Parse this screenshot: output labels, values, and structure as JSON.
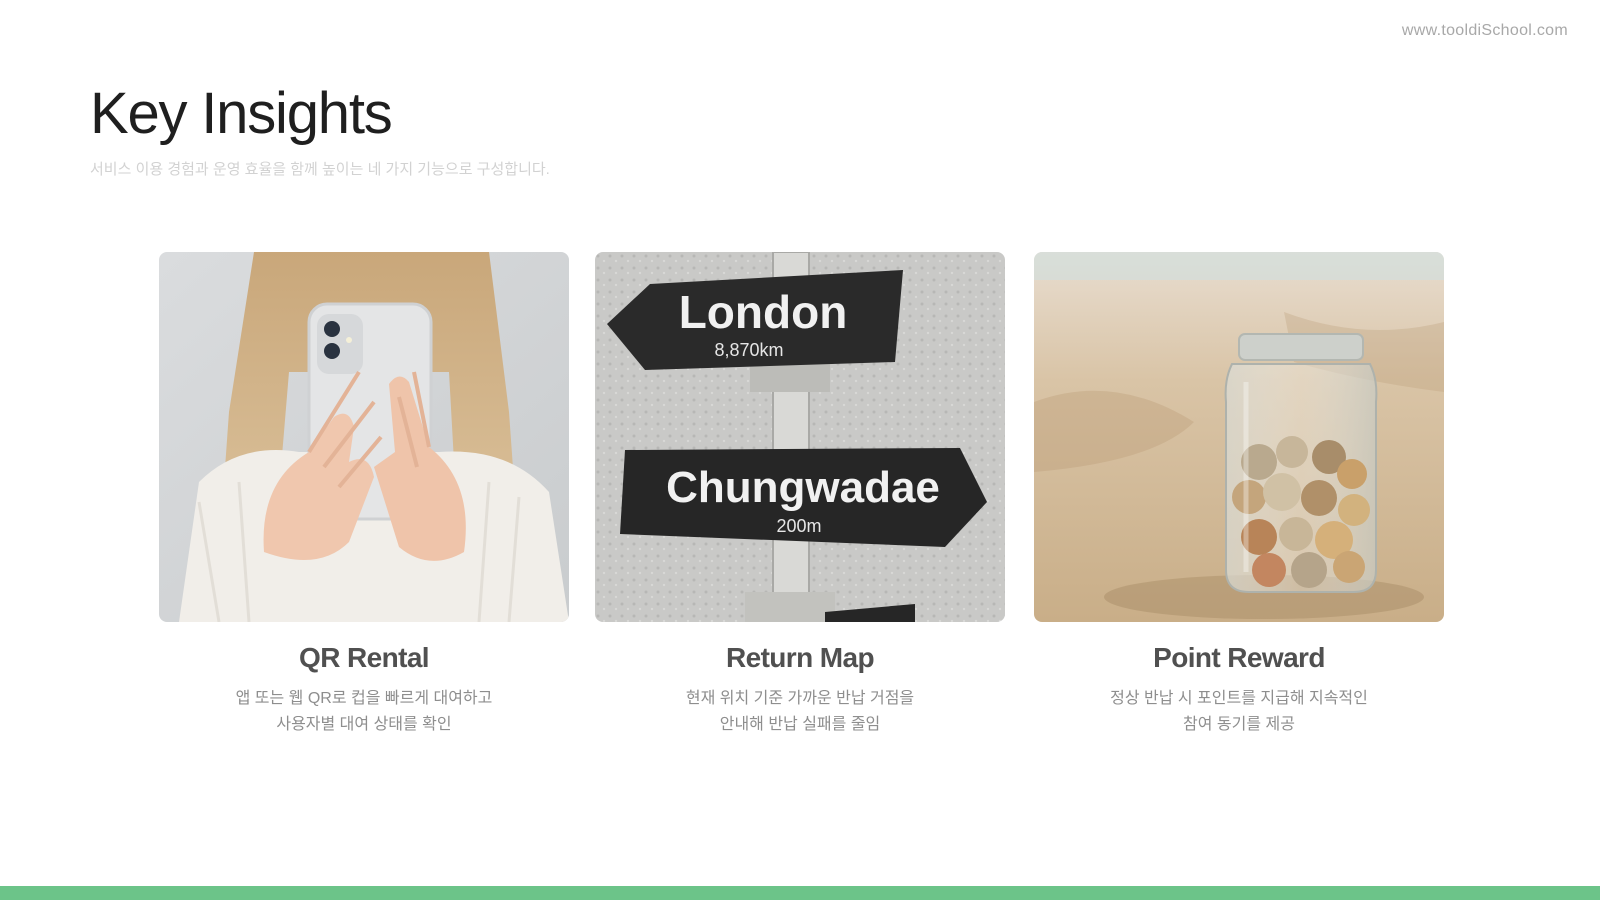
{
  "header": {
    "site_url": "www.tooldiSchool.com",
    "title": "Key Insights",
    "subtitle": "서비스 이용 경험과 운영 효율을 함께 높이는 네 가지 기능으로 구성합니다."
  },
  "cards": [
    {
      "title": "QR Rental",
      "desc_line1": "앱 또는 웹 QR로 컵을 빠르게 대여하고",
      "desc_line2": "사용자별 대여 상태를 확인",
      "image": "woman-holding-phone-photo"
    },
    {
      "title": "Return Map",
      "desc_line1": "현재 위치 기준 가까운 반납 거점을",
      "desc_line2": "안내해 반납 실패를 줄임",
      "image": "direction-signpost-photo",
      "sign_top": "London",
      "sign_top_distance": "8,870km",
      "sign_bottom": "Chungwadae",
      "sign_bottom_distance": "200m"
    },
    {
      "title": "Point Reward",
      "desc_line1": "정상 반납 시 포인트를 지급해 지속적인",
      "desc_line2": "참여 동기를 제공",
      "image": "coin-jar-on-sand-photo"
    }
  ],
  "colors": {
    "accent_bar": "#6cc489",
    "title": "#1f1f1f",
    "card_title": "#505050",
    "desc": "#8e8e8e"
  }
}
